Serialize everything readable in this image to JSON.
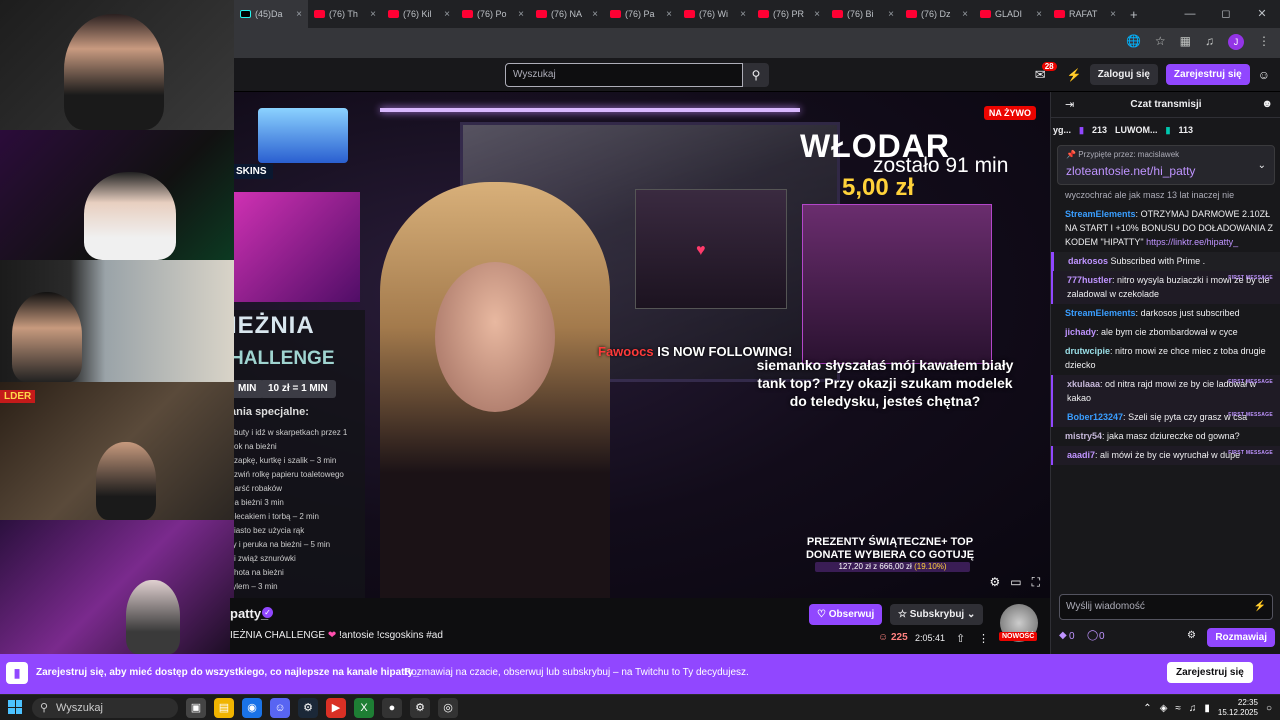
{
  "browser": {
    "tabs": [
      {
        "label": "(45)Da",
        "icon": "tiktok-icon"
      },
      {
        "label": "(76) Th",
        "icon": "youtube-icon"
      },
      {
        "label": "(76) Kil",
        "icon": "youtube-icon"
      },
      {
        "label": "(76) Po",
        "icon": "youtube-icon"
      },
      {
        "label": "(76) NA",
        "icon": "youtube-icon"
      },
      {
        "label": "(76) Pa",
        "icon": "youtube-icon"
      },
      {
        "label": "(76) Wi",
        "icon": "youtube-icon"
      },
      {
        "label": "(76) PR",
        "icon": "youtube-icon"
      },
      {
        "label": "(76) Bi",
        "icon": "youtube-icon"
      },
      {
        "label": "(76) Dz",
        "icon": "youtube-icon"
      },
      {
        "label": "GLADI",
        "icon": "youtube-icon"
      },
      {
        "label": "RAFAT",
        "icon": "youtube-icon"
      }
    ],
    "new_tab": "+",
    "profile_initial": "J"
  },
  "twitch_nav": {
    "search_placeholder": "Wyszukaj",
    "inbox_count": "28",
    "login_label": "Zaloguj się",
    "signup_label": "Zarejestruj się"
  },
  "stream_overlay": {
    "live_badge": "NA ŻYWO",
    "skins_label": "SKINS",
    "challenge_title_1": "IEŻNIA",
    "challenge_title_2": "HALLENGE",
    "pill_left": "MIN",
    "pill_right": "10 zł = 1 MIN",
    "tasks_header": "ania specjalne:",
    "tasks": [
      "j buty i idź w skarpetkach przez 1",
      "sok na bieżni",
      "czapkę, kurtkę i szalik – 3 min",
      "i zwiń rolkę papieru toaletowego",
      "garść robaków",
      "na bieżni 3 min",
      "plecakiem i torbą – 2 min",
      "ciasto bez użycia rąk",
      "ry i peruka na bieżni – 5 min",
      "j i zwiąż sznurówki",
      "shota na bieżni",
      "tylem – 3 min"
    ],
    "timer_name": "WŁODAR",
    "timer_left": "zostało 91 min",
    "timer_price": "5,00 zł",
    "follow_user": "Fawoocs",
    "follow_text": "IS NOW FOLLOWING!",
    "alert_text": "siemanko słyszałaś mój kawałem biały tank top? Przy okazji szukam modelek do teledysku, jesteś chętna?",
    "gifts_title": "PREZENTY ŚWIĄTECZNE+ TOP DONATE WYBIERA CO GOTUJĘ",
    "gifts_progress": "127,20 zł z 666,00 zł",
    "gifts_percent": "(19.10%)",
    "gifts_fraction": 0.191
  },
  "webcams": {
    "cam4_tag": "LDER"
  },
  "channel": {
    "name": "patty_",
    "title_prefix": "IEŻNIA CHALLENGE",
    "title_suffix": "!antosie !csgoskins #ad",
    "follow_label": "Obserwuj",
    "subscribe_label": "Subskrybuj",
    "viewers": "225",
    "uptime": "2:05:41",
    "new_badge": "NOWOŚĆ"
  },
  "chat": {
    "header": "Czat transmisji",
    "leaderboard": [
      {
        "name": "yg...",
        "count": "213"
      },
      {
        "name": "LUWOM...",
        "count": "113"
      }
    ],
    "pinned_by": "Przypięte przez:",
    "pinned_by_user": "macislawek",
    "pinned_link": "zloteantosie.net/hi_patty",
    "messages": [
      {
        "user": "",
        "text": "wyczochrać ale jak masz 13 lat inaczej nie",
        "first": false,
        "color": "#adadb8"
      },
      {
        "user": "StreamElements",
        "text": "OTRZYMAJ DARMOWE 2.10ZŁ NA START I +10% BONUSU DO DOŁADOWANIA Z KODEM \"HIPATTY\"",
        "link": "https://linktr.ee/hipatty_",
        "first": false,
        "color": "#3a9eff"
      },
      {
        "user": "darkosos",
        "text": "Subscribed with Prime .",
        "first": false,
        "sub": true,
        "color": "#bf94ff"
      },
      {
        "user": "777hustler",
        "text": "nitro wysyla buziaczki i mowi ze by cie zaladowal w czekolade",
        "first": true,
        "color": "#bf94ff"
      },
      {
        "user": "StreamElements",
        "text": "darkosos just subscribed",
        "first": false,
        "color": "#3a9eff",
        "mention": "darkosos"
      },
      {
        "user": "jichady",
        "text": "ale bym cie zbombardował w cyce",
        "first": false,
        "color": "#bf94ff"
      },
      {
        "user": "drutwcipie",
        "text": "nitro mowi ze chce miec z toba drugie dziecko",
        "first": false,
        "color": "#9adfe6"
      },
      {
        "user": "xkulaaa",
        "text": "od nitra rajd mowi ze by cie ladował w kakao",
        "first": true,
        "color": "#c6b8d9"
      },
      {
        "user": "Bober123247",
        "text": "Szeli się pyta czy grasz w csa",
        "first": true,
        "color": "#3a9eff"
      },
      {
        "user": "mistry54",
        "text": "jaka masz dziureczke od gowna?",
        "first": false,
        "color": "#c6b8d9"
      },
      {
        "user": "aaadi7",
        "text": "ali mówi że by cie wyruchał w dupe",
        "first": true,
        "color": "#bf94ff"
      }
    ],
    "first_message_label": "FIRST MESSAGE",
    "input_placeholder": "Wyślij wiadomość",
    "points_1": "0",
    "points_2": "0",
    "send_label": "Rozmawiaj"
  },
  "banner": {
    "bold_text": "Zarejestruj się, aby mieć dostęp do wszystkiego, co najlepsze na kanale hipatty_",
    "rest_text": "Rozmawiaj na czacie, obserwuj lub subskrybuj – na Twitchu to Ty decydujesz.",
    "cta": "Zarejestruj się"
  },
  "taskbar": {
    "search_label": "Wyszukaj",
    "time": "22:35",
    "date": "15.12.2025"
  }
}
